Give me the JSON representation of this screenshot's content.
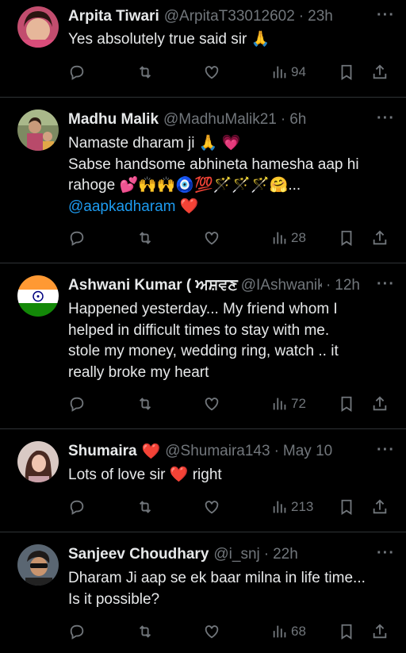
{
  "replies": [
    {
      "name": "Arpita Tiwari",
      "handle": "@ArpitaT33012602",
      "time": "23h",
      "lines": [
        "Yes absolutely true said sir 🙏"
      ],
      "views": "94"
    },
    {
      "name": "Madhu Malik",
      "handle": "@MadhuMalik21",
      "time": "6h",
      "lines": [
        "Namaste dharam ji 🙏 💗",
        "Sabse handsome abhineta hamesha aap hi",
        "rahoge 💕🙌🙌🧿💯🪄🪄🪄🤗..."
      ],
      "mention": "@aapkadharam",
      "mention_suffix": " ❤️",
      "views": "28"
    },
    {
      "name": "Ashwani Kumar ( ਅਸ਼ਵਣ",
      "handle": "@IAshwanik",
      "time": "12h",
      "lines": [
        "Happened yesterday... My friend whom I",
        "helped in difficult times to stay with me.",
        "stole my money, wedding ring, watch .. it",
        "really broke my heart"
      ],
      "views": "72"
    },
    {
      "name": "Shumaira",
      "name_suffix": "❤️",
      "handle": "@Shumaira143",
      "time": "May 10",
      "lines": [
        "Lots of love sir ❤️ right"
      ],
      "views": "213"
    },
    {
      "name": "Sanjeev Choudhary",
      "handle": "@i_snj",
      "time": "22h",
      "lines": [
        "Dharam Ji  aap se ek baar milna in life time...",
        "Is it possible?"
      ],
      "views": "68"
    }
  ],
  "icons": {
    "more": "more-horizontal-icon",
    "reply": "reply-icon",
    "retweet": "retweet-icon",
    "like": "heart-icon",
    "views": "views-icon",
    "bookmark": "bookmark-icon",
    "share": "share-icon"
  },
  "colors": {
    "background": "#000000",
    "text": "#e7e9ea",
    "muted": "#71767b",
    "link": "#1d9bf0",
    "divider": "#2f3336"
  }
}
